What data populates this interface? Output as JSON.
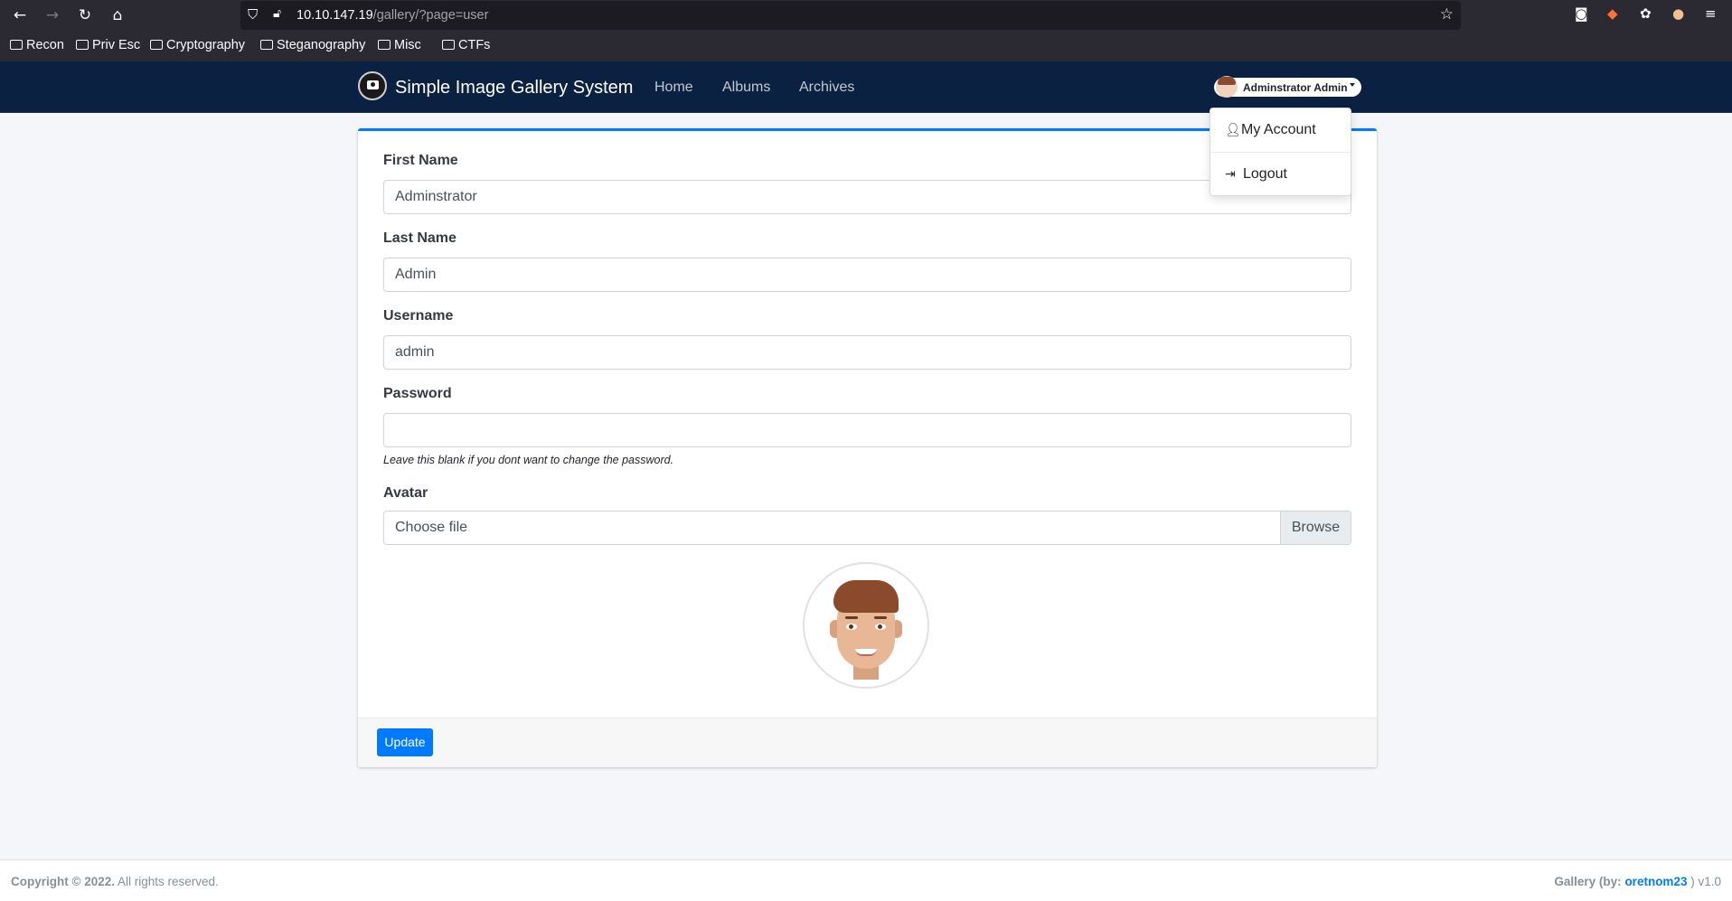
{
  "browser": {
    "url_host": "10.10.147.19",
    "url_path": "/gallery/?page=user",
    "bookmarks": [
      "Recon",
      "Priv Esc",
      "Cryptography",
      "Steganography",
      "Misc",
      "CTFs"
    ]
  },
  "navbar": {
    "brand": "Simple Image Gallery System",
    "links": [
      "Home",
      "Albums",
      "Archives"
    ],
    "user_name": "Adminstrator Admin"
  },
  "dropdown": {
    "my_account": "My Account",
    "logout": "Logout"
  },
  "form": {
    "first_name_label": "First Name",
    "first_name_value": "Adminstrator",
    "last_name_label": "Last Name",
    "last_name_value": "Admin",
    "username_label": "Username",
    "username_value": "admin",
    "password_label": "Password",
    "password_value": "",
    "password_hint": "Leave this blank if you dont want to change the password.",
    "avatar_label": "Avatar",
    "file_placeholder": "Choose file",
    "browse_label": "Browse",
    "update_label": "Update"
  },
  "footer": {
    "copyright": "Copyright © 2022.",
    "rights": "All rights reserved.",
    "gallery_by": "Gallery (by:",
    "author": "oretnom23",
    "version_suffix": ") v1.0"
  },
  "colors": {
    "navbar_bg": "#0b2142",
    "accent": "#007bff"
  }
}
